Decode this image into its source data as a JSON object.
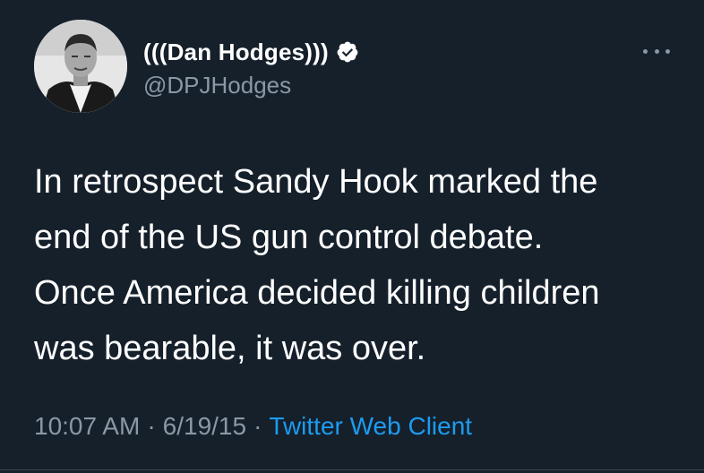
{
  "tweet": {
    "display_name": "(((Dan Hodges)))",
    "handle": "@DPJHodges",
    "text_lines": [
      "In retrospect Sandy Hook marked the",
      "end of the US gun control debate.",
      "Once America decided killing children",
      "was bearable, it was over."
    ],
    "time": "10:07 AM",
    "date": "6/19/15",
    "separator": "·",
    "client": "Twitter Web Client"
  },
  "icons": {
    "verified": "verified-badge-icon",
    "more": "more-options-icon"
  },
  "colors": {
    "background": "#15202b",
    "text_primary": "#ffffff",
    "text_secondary": "#8b98a5",
    "link": "#1d9bf0"
  }
}
